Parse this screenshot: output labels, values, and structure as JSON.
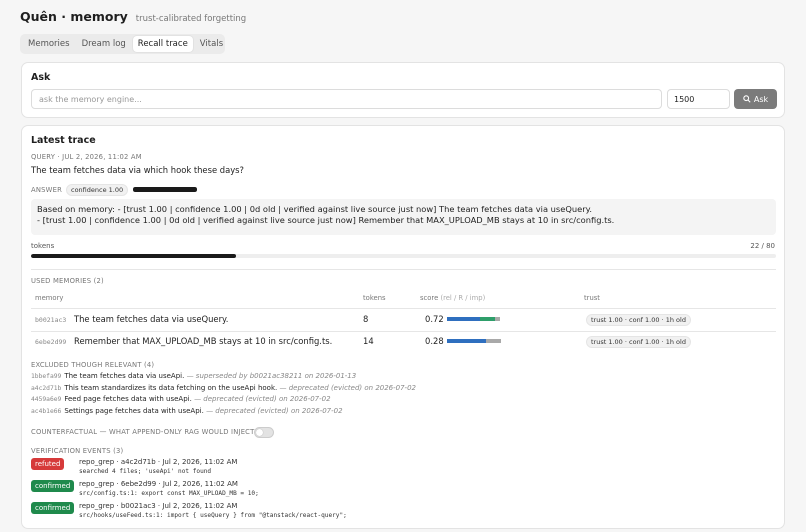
{
  "app": {
    "title": "Quên · memory",
    "tagline": "trust-calibrated forgetting"
  },
  "tabs": [
    {
      "label": "Memories",
      "active": false
    },
    {
      "label": "Dream log",
      "active": false
    },
    {
      "label": "Recall trace",
      "active": true
    },
    {
      "label": "Vitals",
      "active": false
    }
  ],
  "ask": {
    "title": "Ask",
    "placeholder": "ask the memory engine...",
    "budget_value": "1500",
    "button_label": "Ask",
    "button_icon": "search-icon"
  },
  "trace": {
    "title": "Latest trace",
    "query_meta": "QUERY · JUL 2, 2026, 11:02 AM",
    "query_text": "The team fetches data via which hook these days?",
    "answer_label": "ANSWER",
    "confidence_pill": "confidence 1.00",
    "confidence_value": 1.0,
    "answer_lines": [
      "Based on memory: - [trust 1.00 | confidence 1.00 | 0d old | verified against live source just now] The team fetches data via useQuery.",
      "- [trust 1.00 | confidence 1.00 | 0d old | verified against live source just now] Remember that MAX_UPLOAD_MB stays at 10 in src/config.ts."
    ],
    "tokens_label": "tokens",
    "tokens_count": "22 / 80",
    "tokens_used": 22,
    "tokens_budget": 80
  },
  "used": {
    "title": "USED MEMORIES (2)",
    "headers": {
      "memory": "memory",
      "tokens": "tokens",
      "score": "score",
      "score_sub": "(rel / R / imp)",
      "trust": "trust"
    },
    "rows": [
      {
        "id": "b0021ac3",
        "text": "The team fetches data via useQuery.",
        "tokens": "8",
        "score": "0.72",
        "rel": 0.65,
        "r": 0.3,
        "imp": 0.1,
        "trust": "trust 1.00 · conf 1.00 · 1h old"
      },
      {
        "id": "6ebe2d99",
        "text": "Remember that MAX_UPLOAD_MB stays at 10 in src/config.ts.",
        "tokens": "14",
        "score": "0.28",
        "rel": 0.75,
        "r": 0.0,
        "imp": 0.3,
        "trust": "trust 1.00 · conf 1.00 · 1h old"
      }
    ],
    "colors": {
      "rel": "#2f6fbf",
      "r": "#2e9e6a",
      "imp": "#a9a9a9"
    }
  },
  "excluded": {
    "title": "EXCLUDED THOUGH RELEVANT (4)",
    "items": [
      {
        "id": "1bbefa99",
        "text": "The team fetches data via useApi.",
        "reason": "— superseded by b0021ac38211 on 2026-01-13"
      },
      {
        "id": "a4c2d71b",
        "text": "This team standardizes its data fetching on the useApi hook.",
        "reason": "— deprecated (evicted) on 2026-07-02"
      },
      {
        "id": "4459a6e9",
        "text": "Feed page fetches data with useApi.",
        "reason": "— deprecated (evicted) on 2026-07-02"
      },
      {
        "id": "ac4b1e66",
        "text": "Settings page fetches data with useApi.",
        "reason": "— deprecated (evicted) on 2026-07-02"
      }
    ]
  },
  "counterfactual": {
    "label": "COUNTERFACTUAL — WHAT APPEND-ONLY RAG WOULD INJECT",
    "enabled": false
  },
  "verification": {
    "title": "VERIFICATION EVENTS (3)",
    "events": [
      {
        "status": "refuted",
        "color": "#d63a3a",
        "title": "repo_grep · a4c2d71b · Jul 2, 2026, 11:02 AM",
        "detail": "searched 4 files; 'useApi' not found"
      },
      {
        "status": "confirmed",
        "color": "#1f8a4c",
        "title": "repo_grep · 6ebe2d99 · Jul 2, 2026, 11:02 AM",
        "detail": "src/config.ts:1: export const MAX_UPLOAD_MB = 10;"
      },
      {
        "status": "confirmed",
        "color": "#1f8a4c",
        "title": "repo_grep · b0021ac3 · Jul 2, 2026, 11:02 AM",
        "detail": "src/hooks/useFeed.ts:1: import { useQuery } from \"@tanstack/react-query\";"
      }
    ]
  }
}
